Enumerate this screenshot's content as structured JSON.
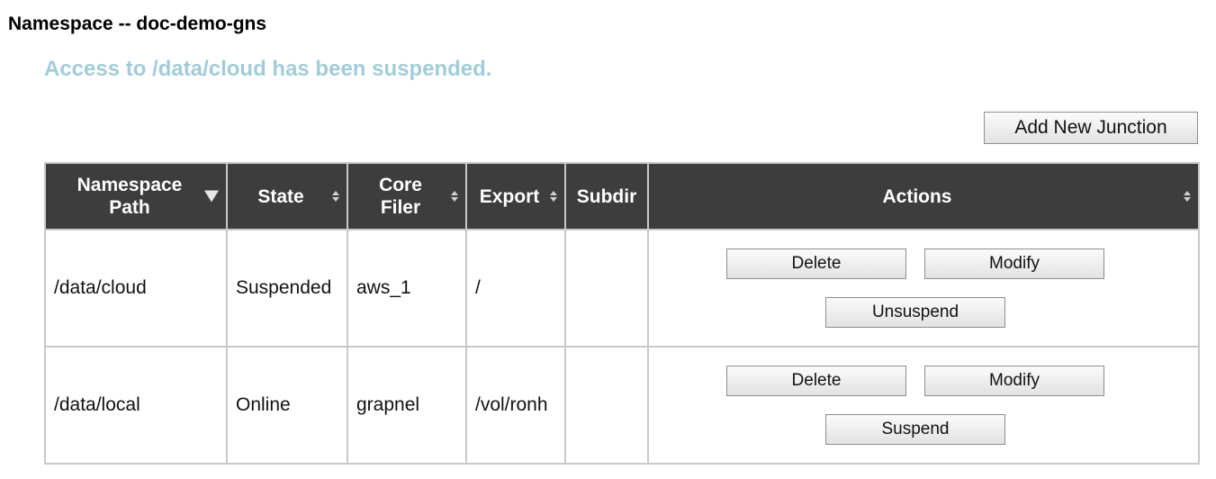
{
  "page": {
    "title": "Namespace -- doc-demo-gns",
    "status_message": "Access to /data/cloud has been suspended."
  },
  "toolbar": {
    "add_junction_label": "Add New Junction"
  },
  "table": {
    "headers": {
      "namespace_path": "Namespace Path",
      "state": "State",
      "core_filer": "Core Filer",
      "export": "Export",
      "subdir": "Subdir",
      "actions": "Actions"
    },
    "rows": [
      {
        "namespace_path": "/data/cloud",
        "state": "Suspended",
        "core_filer": "aws_1",
        "export": "/",
        "subdir": "",
        "delete_label": "Delete",
        "modify_label": "Modify",
        "toggle_label": "Unsuspend"
      },
      {
        "namespace_path": "/data/local",
        "state": "Online",
        "core_filer": "grapnel",
        "export": "/vol/ronh",
        "subdir": "",
        "delete_label": "Delete",
        "modify_label": "Modify",
        "toggle_label": "Suspend"
      }
    ]
  },
  "colors": {
    "header_bg": "#3d3d3d",
    "status_message": "#a3ccd9",
    "border": "#c9c9c9"
  },
  "icons": {
    "sorted_column": "sort-desc-icon",
    "sortable_column": "sort-icon"
  }
}
